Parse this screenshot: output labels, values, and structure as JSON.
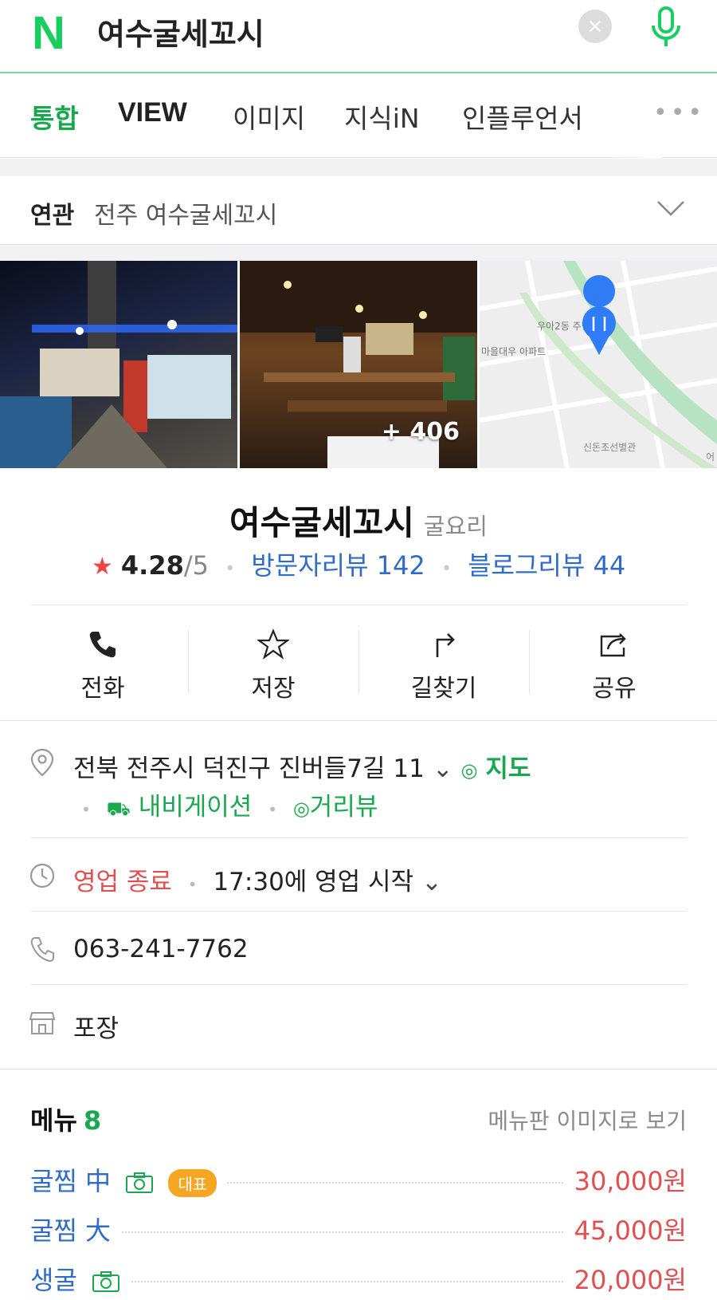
{
  "search": {
    "logo": "N",
    "query": "여수굴세꼬시",
    "clear_symbol": "×"
  },
  "tabs": [
    {
      "label": "통합",
      "active": true
    },
    {
      "label": "VIEW"
    },
    {
      "label": "이미지"
    },
    {
      "label": "지식iN"
    },
    {
      "label": "인플루언서"
    }
  ],
  "tabs_more": "•••",
  "related": {
    "label": "연관",
    "term": "전주 여수굴세꼬시"
  },
  "photos": {
    "count_label": "+ 406"
  },
  "map_labels": {
    "center": "우아2동 주민센터",
    "apartment": "마을대우 아파트",
    "restaurant": "신돈조선별관",
    "edge": "어"
  },
  "place": {
    "name": "여수굴세꼬시",
    "category": "굴요리",
    "rating_star": "★",
    "rating": "4.28",
    "rating_max": "/5",
    "visitor_reviews": "방문자리뷰 142",
    "blog_reviews": "블로그리뷰 44"
  },
  "actions": [
    {
      "label": "전화",
      "icon": "phone-icon"
    },
    {
      "label": "저장",
      "icon": "star-icon"
    },
    {
      "label": "길찾기",
      "icon": "directions-icon"
    },
    {
      "label": "공유",
      "icon": "share-icon"
    }
  ],
  "info": {
    "address": "전북 전주시 덕진구 진버들7길 11",
    "map_link": "지도",
    "navigation_link": "내비게이션",
    "streetview_link": "거리뷰",
    "status": "영업 종료",
    "next_open": "17:30에 영업 시작",
    "phone": "063-241-7762",
    "service": "포장"
  },
  "menu": {
    "title": "메뉴",
    "count": "8",
    "board_link": "메뉴판 이미지로 보기",
    "items": [
      {
        "name": "굴찜 中",
        "price": "30,000원",
        "has_photo": true,
        "badge": "대표"
      },
      {
        "name": "굴찜 大",
        "price": "45,000원",
        "has_photo": false
      },
      {
        "name": "생굴",
        "price": "20,000원",
        "has_photo": true
      }
    ]
  },
  "colors": {
    "brand_green": "#19ce60",
    "link_blue": "#2f6cc7",
    "price_red": "#e05050",
    "badge_orange": "#f5a623"
  }
}
